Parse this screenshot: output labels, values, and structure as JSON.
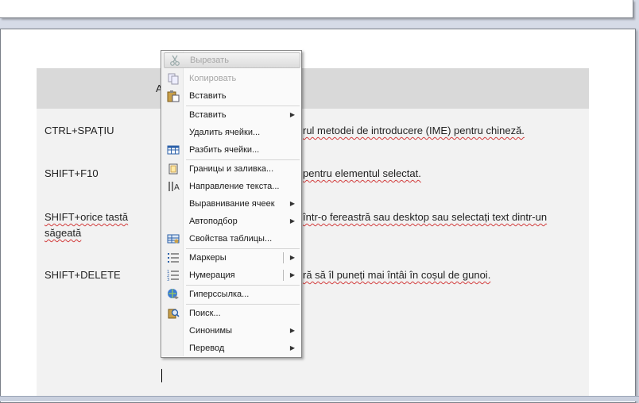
{
  "table": {
    "header": "A",
    "rows": [
      {
        "key": "CTRL+SPAȚIU",
        "desc": "rul metodei de introducere (IME) pentru chineză."
      },
      {
        "key": "SHIFT+F10",
        "desc": "pentru elementul selectat."
      },
      {
        "key": "SHIFT+orice tastă săgeată",
        "desc": "într-o fereastră sau desktop sau selectați text dintr-un"
      },
      {
        "key": "SHIFT+DELETE",
        "desc": "ră să îl puneți mai întâi în coșul de gunoi."
      }
    ]
  },
  "context_menu": {
    "items": [
      {
        "label": "Вырезать",
        "icon": "scissors-icon",
        "disabled": true
      },
      {
        "label": "Копировать",
        "icon": "copy-icon",
        "disabled": true
      },
      {
        "label": "Вставить",
        "icon": "paste-icon"
      },
      {
        "label": "Вставить",
        "submenu": true
      },
      {
        "label": "Удалить ячейки..."
      },
      {
        "label": "Разбить ячейки...",
        "icon": "split-cells-icon"
      },
      {
        "label": "Границы и заливка...",
        "icon": "borders-icon"
      },
      {
        "label": "Направление текста...",
        "icon": "text-direction-icon"
      },
      {
        "label": "Выравнивание ячеек",
        "submenu": true
      },
      {
        "label": "Автоподбор",
        "submenu": true
      },
      {
        "label": "Свойства таблицы...",
        "icon": "table-properties-icon"
      },
      {
        "label": "Маркеры",
        "icon": "bullets-icon",
        "submenu": true
      },
      {
        "label": "Нумерация",
        "icon": "numbering-icon",
        "submenu": true
      },
      {
        "label": "Гиперссылка...",
        "icon": "hyperlink-icon"
      },
      {
        "label": "Поиск...",
        "icon": "research-icon"
      },
      {
        "label": "Синонимы",
        "submenu": true
      },
      {
        "label": "Перевод",
        "submenu": true
      }
    ]
  },
  "colors": {
    "menu_highlight": "#e0e0e0",
    "table_bg": "#f2f2f2",
    "table_header_bg": "#d9d9d9",
    "spell_underline": "#d23c3c"
  }
}
